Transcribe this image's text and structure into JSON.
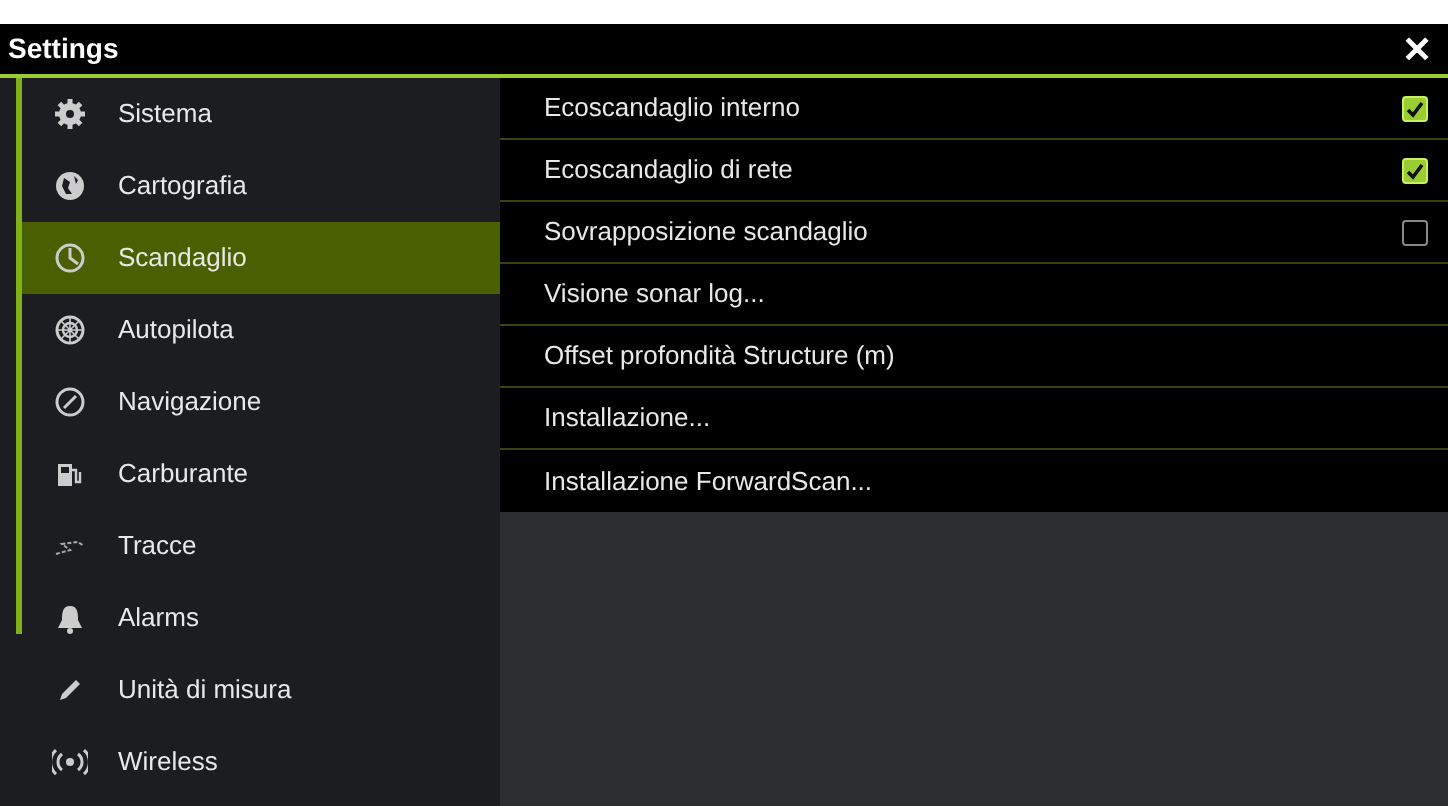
{
  "window": {
    "title": "Settings",
    "close": "✕"
  },
  "sidebar": {
    "items": [
      {
        "label": "Sistema",
        "selected": false
      },
      {
        "label": "Cartografia",
        "selected": false
      },
      {
        "label": "Scandaglio",
        "selected": true
      },
      {
        "label": "Autopilota",
        "selected": false
      },
      {
        "label": "Navigazione",
        "selected": false
      },
      {
        "label": "Carburante",
        "selected": false
      },
      {
        "label": "Tracce",
        "selected": false
      },
      {
        "label": "Alarms",
        "selected": false
      },
      {
        "label": "Unità di misura",
        "selected": false
      },
      {
        "label": "Wireless",
        "selected": false
      }
    ]
  },
  "options": [
    {
      "label": "Ecoscandaglio interno",
      "kind": "checkbox",
      "checked": true
    },
    {
      "label": "Ecoscandaglio di rete",
      "kind": "checkbox",
      "checked": true
    },
    {
      "label": "Sovrapposizione scandaglio",
      "kind": "checkbox",
      "checked": false
    },
    {
      "label": "Visione sonar log...",
      "kind": "action"
    },
    {
      "label": "Offset profondità Structure (m)",
      "kind": "action"
    },
    {
      "label": "Installazione...",
      "kind": "action"
    },
    {
      "label": "Installazione ForwardScan...",
      "kind": "action"
    }
  ]
}
